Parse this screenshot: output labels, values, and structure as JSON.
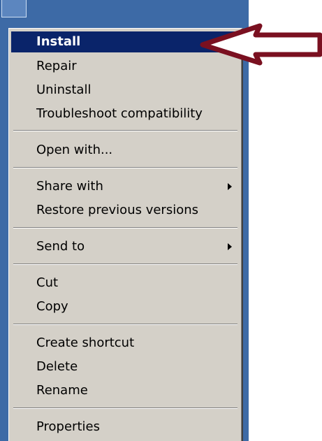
{
  "menu": {
    "items": [
      {
        "label": "Install",
        "highlighted": true
      },
      {
        "label": "Repair"
      },
      {
        "label": "Uninstall"
      },
      {
        "label": "Troubleshoot compatibility"
      },
      {
        "label": "Open with..."
      },
      {
        "label": "Share with",
        "has_submenu": true
      },
      {
        "label": "Restore previous versions"
      },
      {
        "label": "Send to",
        "has_submenu": true
      },
      {
        "label": "Cut"
      },
      {
        "label": "Copy"
      },
      {
        "label": "Create shortcut"
      },
      {
        "label": "Delete"
      },
      {
        "label": "Rename"
      },
      {
        "label": "Properties"
      }
    ]
  },
  "colors": {
    "highlight": "#0a246a",
    "menu_bg": "#d4d0c8",
    "desktop": "#3d6aa6",
    "arrow": "#7a1020"
  },
  "icons": {
    "pointer_arrow": "left-arrow-icon",
    "submenu": "chevron-right-icon"
  }
}
